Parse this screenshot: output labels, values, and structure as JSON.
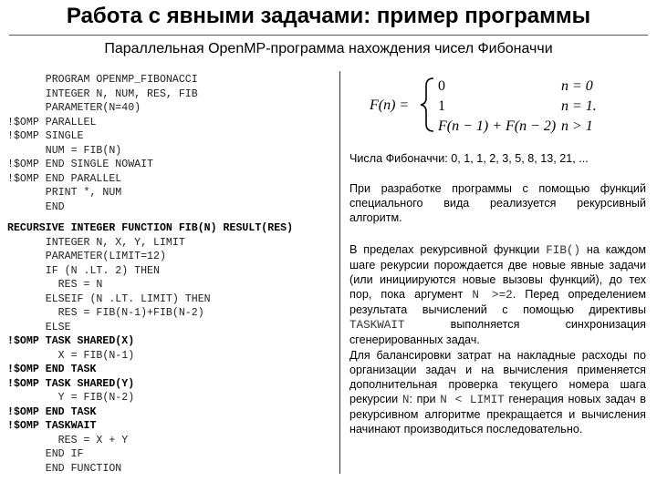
{
  "title": "Работа с явными задачами: пример программы",
  "subtitle": "Параллельная OpenMP-программа нахождения чисел Фибоначчи",
  "code_main": [
    {
      "text": "      PROGRAM OPENMP_FIBONACCI",
      "bold": false
    },
    {
      "text": "      INTEGER N, NUM, RES, FIB",
      "bold": false
    },
    {
      "text": "      PARAMETER(N=40)",
      "bold": false
    },
    {
      "text": "!$OMP PARALLEL",
      "bold": false
    },
    {
      "text": "!$OMP SINGLE",
      "bold": false
    },
    {
      "text": "      NUM = FIB(N)",
      "bold": false
    },
    {
      "text": "!$OMP END SINGLE NOWAIT",
      "bold": false
    },
    {
      "text": "!$OMP END PARALLEL",
      "bold": false
    },
    {
      "text": "      PRINT *, NUM",
      "bold": false
    },
    {
      "text": "      END",
      "bold": false
    }
  ],
  "code_func": [
    {
      "text": "RECURSIVE INTEGER FUNCTION FIB(N) RESULT(RES)",
      "bold": true
    },
    {
      "text": "      INTEGER N, X, Y, LIMIT",
      "bold": false
    },
    {
      "text": "      PARAMETER(LIMIT=12)",
      "bold": false
    },
    {
      "text": "      IF (N .LT. 2) THEN",
      "bold": false
    },
    {
      "text": "        RES = N",
      "bold": false
    },
    {
      "text": "      ELSEIF (N .LT. LIMIT) THEN",
      "bold": false
    },
    {
      "text": "        RES = FIB(N-1)+FIB(N-2)",
      "bold": false
    },
    {
      "text": "      ELSE",
      "bold": false
    },
    {
      "text": "!$OMP TASK SHARED(X)",
      "bold": true
    },
    {
      "text": "        X = FIB(N-1)",
      "bold": false
    },
    {
      "text": "!$OMP END TASK",
      "bold": true
    },
    {
      "text": "!$OMP TASK SHARED(Y)",
      "bold": true
    },
    {
      "text": "        Y = FIB(N-2)",
      "bold": false
    },
    {
      "text": "!$OMP END TASK",
      "bold": true
    },
    {
      "text": "!$OMP TASKWAIT",
      "bold": true
    },
    {
      "text": "        RES = X + Y",
      "bold": false
    },
    {
      "text": "      END IF",
      "bold": false
    },
    {
      "text": "      END FUNCTION",
      "bold": false
    }
  ],
  "formula": {
    "lhs": "F(n) =",
    "cases": [
      {
        "value": "0",
        "cond": "n = 0"
      },
      {
        "value": "1",
        "cond": "n = 1."
      },
      {
        "value": "F(n − 1) + F(n − 2)",
        "cond": "n > 1"
      }
    ]
  },
  "fib_numbers": "Числа Фибоначчи: 0, 1, 1, 2, 3, 5, 8, 13, 21, ...",
  "para1": "При разработке программы с помощью функций специального вида реализуется рекурсивный алгоритм.",
  "para2": {
    "t1": "В пределах рекурсивной функции ",
    "c1": "FIB()",
    "t2": " на каждом шаге рекурсии порождается две новые явные задачи (или инициируются новые вызовы функций), до тех пор, пока аргумент ",
    "c2": "N >=2",
    "t3": ". Перед определением результата вычислений с помощью директивы ",
    "c3": "TASKWAIT",
    "t4": " выполняется синхронизация сгенерированных задач."
  },
  "para3": {
    "t1": "Для балансировки затрат на накладные расходы по организации задач и на вычисления применяется дополнительная проверка текущего номера шага рекурсии ",
    "c1": "N",
    "t2": ": при ",
    "c2": "N < LIMIT",
    "t3": " генерация новых задач в рекурсивном алгоритме прекращается и вычисления начинают производиться последовательно."
  }
}
